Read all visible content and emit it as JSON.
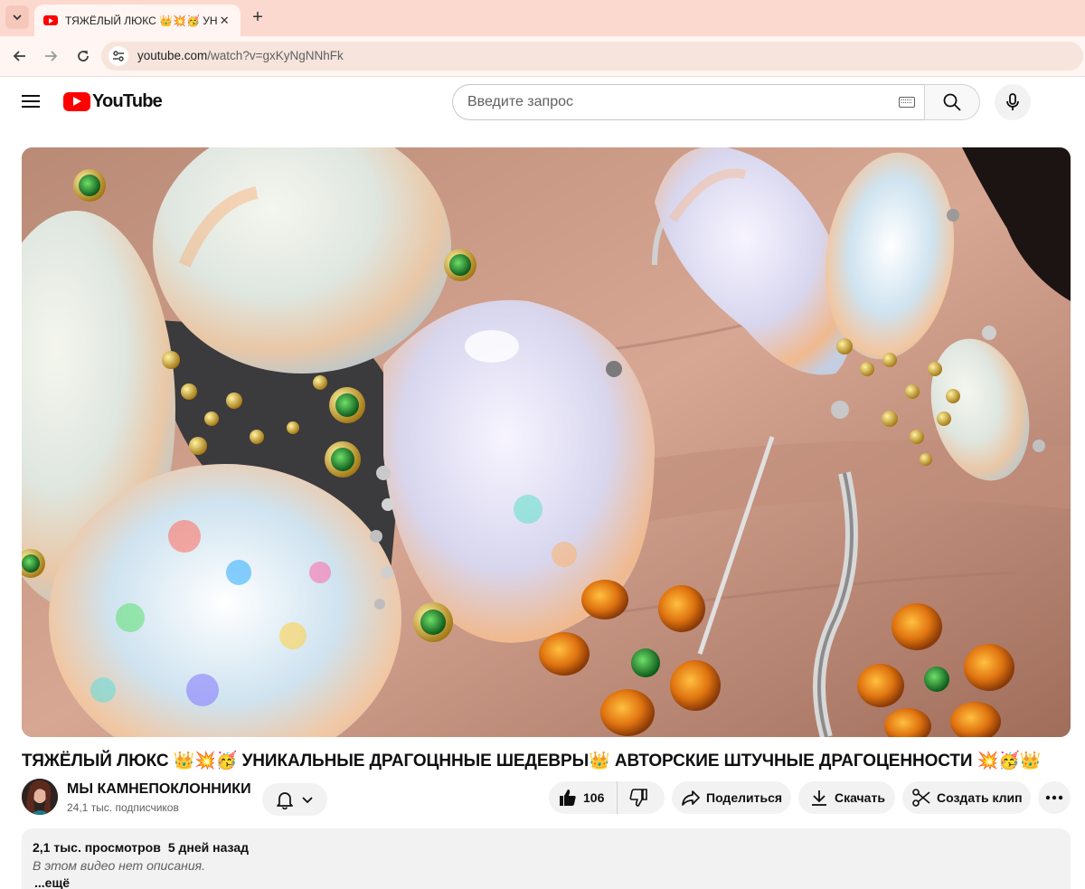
{
  "browser": {
    "tab": {
      "title": "ТЯЖЁЛЫЙ ЛЮКС 👑💥🥳 УНИКАЛЬНЫЕ",
      "close": "✕"
    },
    "new_tab": "+",
    "url_host": "youtube.com",
    "url_rest": "/watch?v=gxKyNgNNhFk"
  },
  "header": {
    "logo_text": "YouTube",
    "search_placeholder": "Введите запрос"
  },
  "video": {
    "title": "ТЯЖЁЛЫЙ ЛЮКС 👑💥🥳 УНИКАЛЬНЫЕ ДРАГОЦННЫЕ ШЕДЕВРЫ👑 АВТОРСКИЕ ШТУЧНЫЕ ДРАГОЦЕННОСТИ 💥🥳👑"
  },
  "owner": {
    "channel_name": "МЫ КАМНЕПОКЛОННИКИ",
    "subscribers": "24,1 тыс. подписчиков"
  },
  "actions": {
    "like_count": "106",
    "share": "Поделиться",
    "download": "Скачать",
    "clip": "Создать клип"
  },
  "description": {
    "views": "2,1 тыс. просмотров",
    "date": "5 дней назад",
    "text": "В этом видео нет описания.",
    "more": "...ещё"
  },
  "colors": {
    "accent": "#ff0000",
    "chip_bg": "#f2f2f2",
    "tabstrip": "#fbd9cf"
  }
}
